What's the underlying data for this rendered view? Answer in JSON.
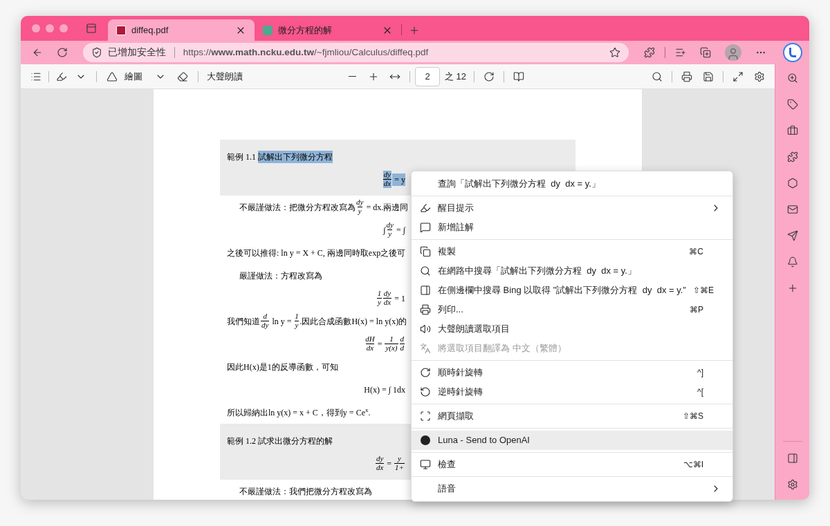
{
  "tabs": [
    {
      "title": "diffeq.pdf",
      "selected": true
    },
    {
      "title": "微分方程的解",
      "selected": false
    }
  ],
  "address_bar": {
    "security": "已增加安全性",
    "url": "https://**www.math.ncku.edu.tw**/~fjmliou/Calculus/diffeq.pdf"
  },
  "pdf_toolbar": {
    "draw_label": "繪圖",
    "read_aloud_label": "大聲朗讀",
    "page_number": "2",
    "page_total": "之 12"
  },
  "document": [
    {
      "kind": "box",
      "lines": [
        {
          "kind": "text",
          "parts": [
            {
              "kind": "text",
              "text": "範例 1.1 ",
              "highlighted": false
            },
            {
              "kind": "text",
              "text": "試解出下列微分方程",
              "highlighted": true
            }
          ]
        },
        {
          "kind": "equation",
          "parts": [
            {
              "kind": "frac",
              "num": "dy",
              "den": "dx",
              "highlighted": true
            },
            {
              "kind": "text",
              "text": " = y",
              "highlighted": true
            }
          ]
        }
      ]
    },
    {
      "kind": "paragraph",
      "parts": [
        {
          "kind": "text",
          "text": "不嚴謹做法：把微分方程改寫為",
          "highlighted": false
        },
        {
          "kind": "frac",
          "num": "dy",
          "den": "y",
          "highlighted": false
        },
        {
          "kind": "text",
          "text": " = dx.兩邊同",
          "highlighted": false
        }
      ]
    },
    {
      "kind": "equation",
      "parts": [
        {
          "kind": "text",
          "text": "∫",
          "highlighted": false
        },
        {
          "kind": "frac",
          "num": "dy",
          "den": "y",
          "highlighted": false
        },
        {
          "kind": "text",
          "text": " = ∫",
          "highlighted": false
        }
      ]
    },
    {
      "kind": "text",
      "parts": [
        {
          "kind": "text",
          "text": "之後可以推得: ln y = X + C, 兩邊同時取exp之後可",
          "highlighted": false
        }
      ]
    },
    {
      "kind": "paragraph",
      "parts": [
        {
          "kind": "text",
          "text": "嚴謹做法：方程改寫為",
          "highlighted": false
        }
      ]
    },
    {
      "kind": "equation",
      "parts": [
        {
          "kind": "frac",
          "num": "1",
          "den": "y",
          "highlighted": false
        },
        {
          "kind": "frac",
          "num": "dy",
          "den": "dx",
          "highlighted": false
        },
        {
          "kind": "text",
          "text": " = 1",
          "highlighted": false
        }
      ]
    },
    {
      "kind": "text",
      "parts": [
        {
          "kind": "text",
          "text": "我們知道",
          "highlighted": false
        },
        {
          "kind": "frac",
          "num": "d",
          "den": "dy",
          "highlighted": false
        },
        {
          "kind": "text",
          "text": " ln y = ",
          "highlighted": false
        },
        {
          "kind": "frac",
          "num": "1",
          "den": "y",
          "highlighted": false
        },
        {
          "kind": "text",
          "text": ".因此合成函數H(x) = ln y(x)的",
          "highlighted": false
        }
      ]
    },
    {
      "kind": "equation",
      "parts": [
        {
          "kind": "frac",
          "num": "dH",
          "den": "dx",
          "highlighted": false
        },
        {
          "kind": "text",
          "text": " = ",
          "highlighted": false
        },
        {
          "kind": "frac",
          "num": "1",
          "den": "y(x)",
          "highlighted": false
        },
        {
          "kind": "frac",
          "num": "d",
          "den": "d",
          "highlighted": false
        }
      ]
    },
    {
      "kind": "text",
      "parts": [
        {
          "kind": "text",
          "text": "因此H(x)是1的反導函數，可知",
          "highlighted": false
        }
      ]
    },
    {
      "kind": "equation",
      "parts": [
        {
          "kind": "text",
          "text": "H(x) = ∫ 1dx",
          "highlighted": false
        }
      ]
    },
    {
      "kind": "text",
      "parts": [
        {
          "kind": "text",
          "text": "所以歸納出ln y(x) = x + C，得到y = Ce$^{x}$.",
          "highlighted": false
        }
      ]
    },
    {
      "kind": "box",
      "lines": [
        {
          "kind": "text",
          "parts": [
            {
              "kind": "text",
              "text": "範例 1.2 試求出微分方程的解",
              "highlighted": false
            }
          ]
        },
        {
          "kind": "equation",
          "parts": [
            {
              "kind": "frac",
              "num": "dy",
              "den": "dx",
              "highlighted": false
            },
            {
              "kind": "text",
              "text": " = ",
              "highlighted": false
            },
            {
              "kind": "frac",
              "num": "y",
              "den": "1+",
              "highlighted": false
            }
          ]
        }
      ]
    },
    {
      "kind": "paragraph",
      "parts": [
        {
          "kind": "text",
          "text": "不嚴謹做法：我們把微分方程改寫為",
          "highlighted": false
        }
      ]
    }
  ],
  "context_menu": [
    [
      {
        "label": "查詢「試解出下列微分方程  dy  dx = y.」",
        "submenu": false,
        "disabled": false,
        "selected": false
      }
    ],
    [
      {
        "label": "醒目提示",
        "submenu": true,
        "disabled": false,
        "selected": false
      },
      {
        "label": "新增註解",
        "submenu": false,
        "disabled": false,
        "selected": false
      }
    ],
    [
      {
        "label": "複製",
        "shortcut": "⌘C",
        "submenu": false,
        "disabled": false,
        "selected": false
      },
      {
        "label": "在網路中搜尋「試解出下列微分方程  dy  dx = y.」",
        "submenu": false,
        "disabled": false,
        "selected": false
      },
      {
        "label": "在側邊欄中搜尋 Bing 以取得 \"試解出下列微分方程  dy  dx = y.\"",
        "shortcut": "⇧⌘E",
        "submenu": false,
        "disabled": false,
        "selected": false
      },
      {
        "label": "列印...",
        "shortcut": "⌘P",
        "submenu": false,
        "disabled": false,
        "selected": false
      },
      {
        "label": "大聲朗讀選取項目",
        "submenu": false,
        "disabled": false,
        "selected": false
      },
      {
        "label": "將選取項目翻譯為 中文（繁體）",
        "submenu": false,
        "disabled": true,
        "selected": false
      }
    ],
    [
      {
        "label": "順時針旋轉",
        "shortcut": "^]",
        "submenu": false,
        "disabled": false,
        "selected": false
      },
      {
        "label": "逆時針旋轉",
        "shortcut": "^[",
        "submenu": false,
        "disabled": false,
        "selected": false
      }
    ],
    [
      {
        "label": "網頁擷取",
        "shortcut": "⇧⌘S",
        "submenu": false,
        "disabled": false,
        "selected": false
      }
    ],
    [
      {
        "label": "Luna - Send to OpenAI",
        "submenu": false,
        "disabled": false,
        "selected": true
      }
    ],
    [
      {
        "label": "檢查",
        "shortcut": "⌥⌘I",
        "submenu": false,
        "disabled": false,
        "selected": false
      }
    ],
    [
      {
        "label": "語音",
        "submenu": true,
        "disabled": false,
        "selected": false
      }
    ]
  ]
}
